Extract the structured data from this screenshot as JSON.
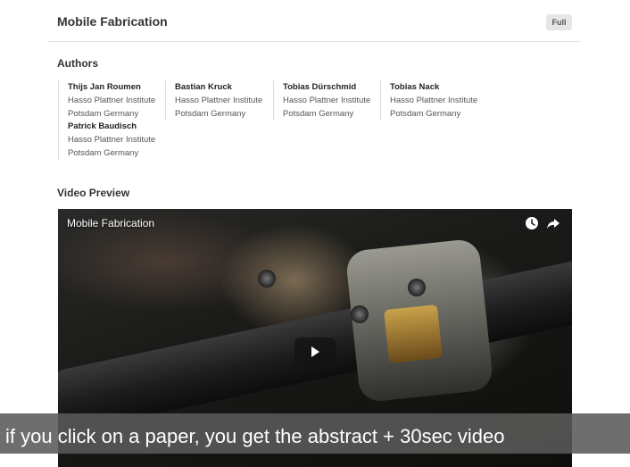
{
  "page": {
    "title": "Mobile Fabrication",
    "badge": "Full"
  },
  "authors_section": {
    "heading": "Authors",
    "authors": [
      {
        "name": "Thijs Jan Roumen",
        "affiliation": "Hasso Plattner Institute",
        "location": "Potsdam Germany"
      },
      {
        "name": "Bastian Kruck",
        "affiliation": "Hasso Plattner Institute",
        "location": "Potsdam Germany"
      },
      {
        "name": "Tobias Dürschmid",
        "affiliation": "Hasso Plattner Institute",
        "location": "Potsdam Germany"
      },
      {
        "name": "Tobias Nack",
        "affiliation": "Hasso Plattner Institute",
        "location": "Potsdam Germany"
      },
      {
        "name": "Patrick Baudisch",
        "affiliation": "Hasso Plattner Institute",
        "location": "Potsdam Germany"
      }
    ]
  },
  "video_section": {
    "heading": "Video Preview",
    "video_title": "Mobile Fabrication",
    "icons": [
      "clock-icon",
      "share-icon",
      "play-icon"
    ]
  },
  "caption": {
    "text": "if you click on a paper, you get the abstract + 30sec video"
  }
}
